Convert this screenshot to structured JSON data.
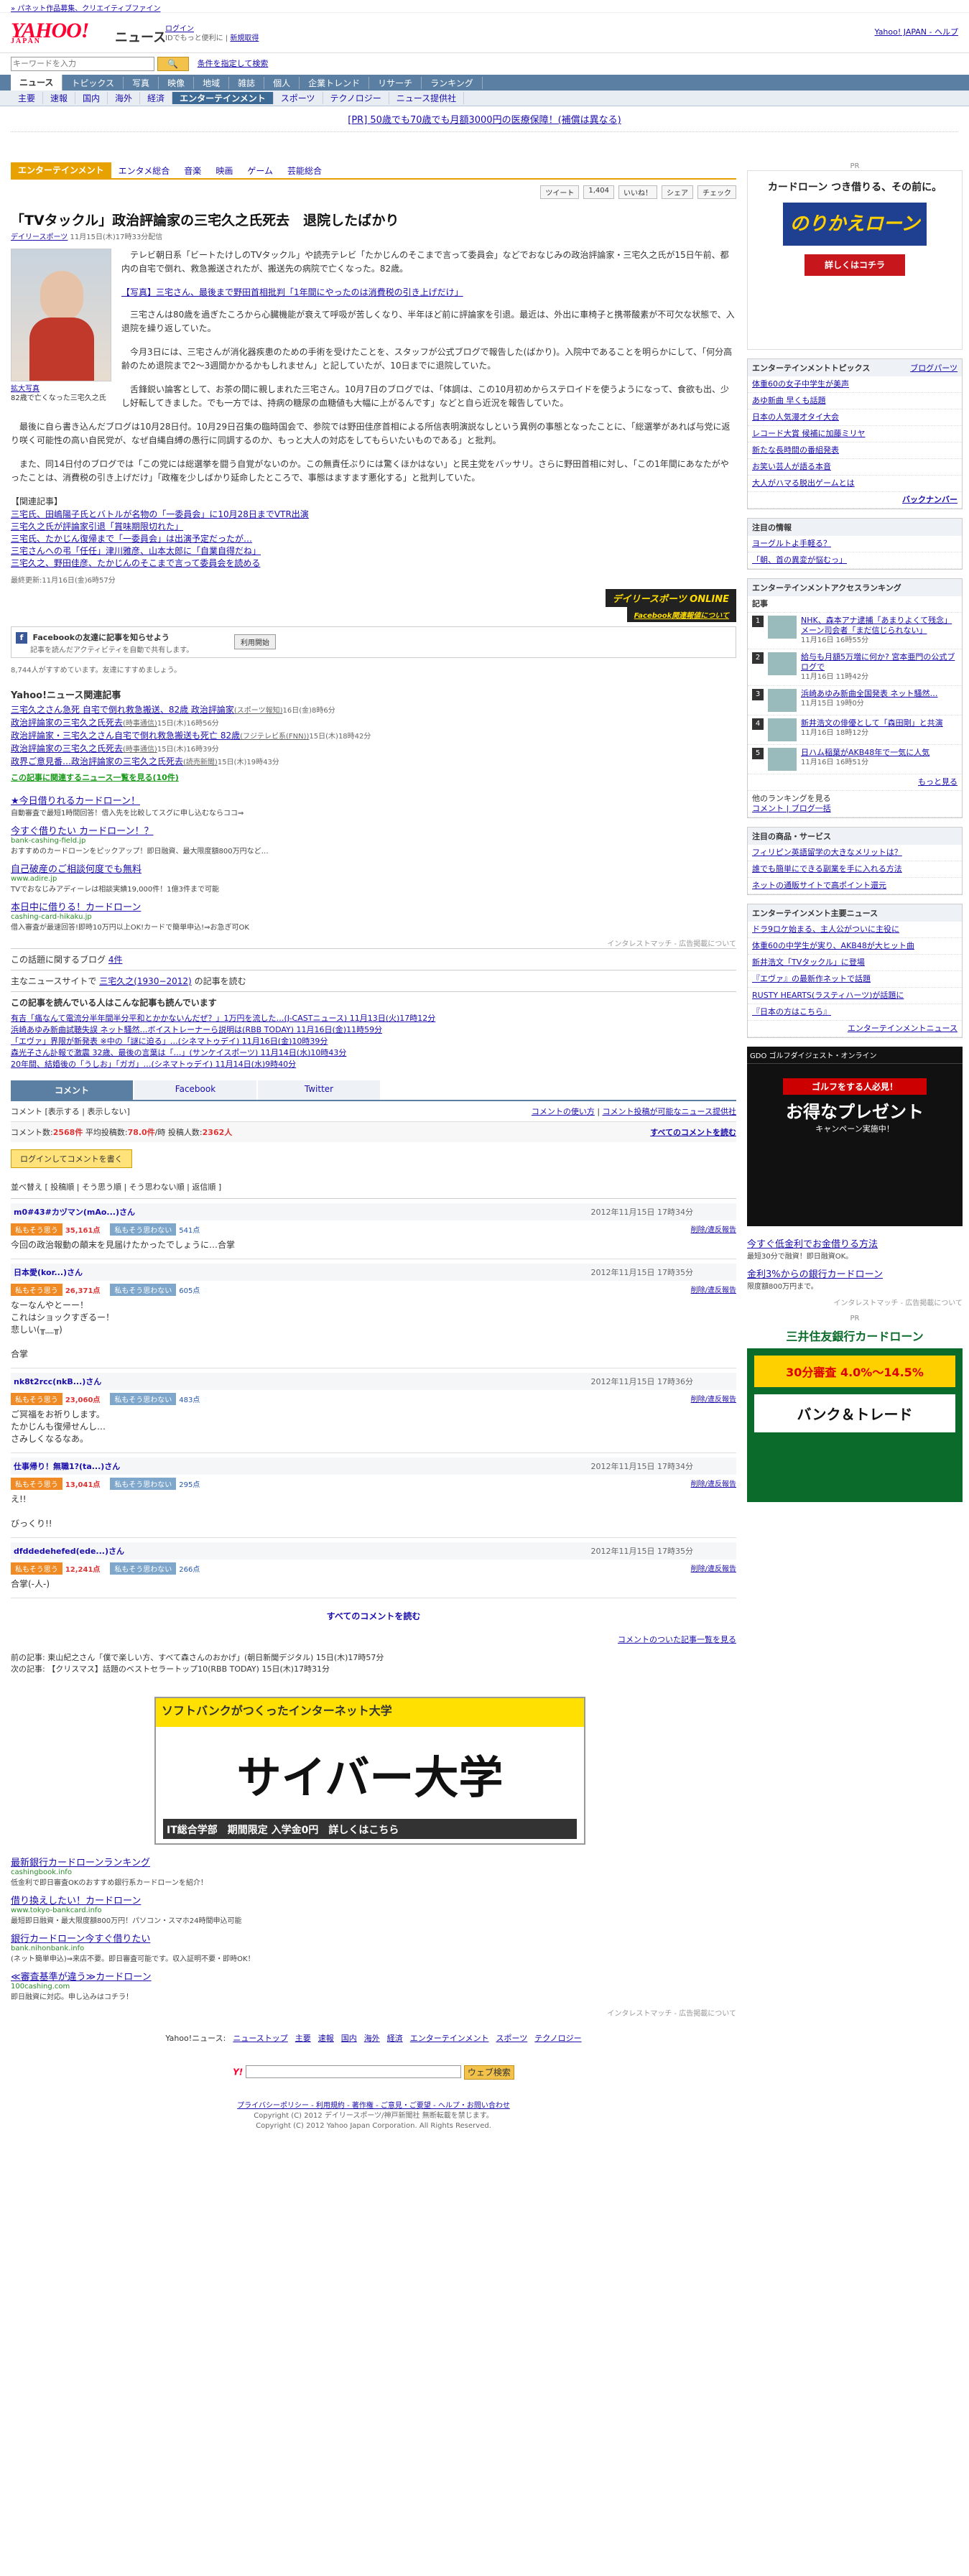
{
  "topbar": {
    "left": "» パネット作品募集、クリエイティブファイン",
    "help": "Yahoo! JAPAN - ヘルプ"
  },
  "header": {
    "logo": "YAHOO!",
    "logo_sub": "JAPAN",
    "section": "ニュース",
    "login_label": "ログイン",
    "login_sub": "IDでもっと便利に",
    "register": "新規取得",
    "right_link": "Yahoo! JAPAN - ヘルプ"
  },
  "search": {
    "placeholder": "キーワードを入力",
    "button": "検索",
    "links": [
      "条件を指定して検索",
      "ヘルプ"
    ]
  },
  "nav_main": [
    "ニュース",
    "トピックス",
    "写真",
    "映像",
    "地域",
    "雑誌",
    "個人",
    "企業トレンド",
    "リサーチ",
    "ランキング"
  ],
  "nav_sub": [
    "主要",
    "速報",
    "国内",
    "海外",
    "経済",
    "エンターテインメント",
    "スポーツ",
    "テクノロジー",
    "ニュース提供社"
  ],
  "pr_line": "[PR] 50歳でも70歳でも月額3000円の医療保障！(補償は異なる)",
  "cat_tabs": [
    "エンターテインメント",
    "エンタメ総合",
    "音楽",
    "映画",
    "ゲーム",
    "芸能総合"
  ],
  "social": {
    "tweet": "ツイート",
    "tweet_count": "1,404",
    "like": "いいね！",
    "share": "シェア",
    "check": "チェック"
  },
  "article": {
    "title": "「TVタックル」政治評論家の三宅久之氏死去　退院したばかり",
    "source": "デイリースポーツ",
    "date": "11月15日(木)17時33分配信",
    "photo_link": "拡大写真",
    "photo_caption": "82歳で亡くなった三宅久之氏",
    "p1": "テレビ朝日系「ビートたけしのTVタックル」や読売テレビ「たかじんのそこまで言って委員会」などでおなじみの政治評論家・三宅久之氏が15日午前、都内の自宅で倒れ、救急搬送されたが、搬送先の病院で亡くなった。82歳。",
    "photo_article_link": "【写真】三宅さん、最後まで野田首相批判「1年間にやったのは消費税の引き上げだけ」",
    "p2": "三宅さんは80歳を過ぎたころから心臓機能が衰えて呼吸が苦しくなり、半年ほど前に評論家を引退。最近は、外出に車椅子と携帯酸素が不可欠な状態で、入退院を繰り返していた。",
    "p3": "今月3日には、三宅さんが消化器疾患のための手術を受けたことを、スタッフが公式ブログで報告した(ばかり)。入院中であることを明らかにして、「何分高齢のため退院まで2〜3週間かかるかもしれません」と記していたが、10日までに退院していた。",
    "p4": "舌鋒鋭い論客として、お茶の間に親しまれた三宅さん。10月7日のブログでは、「体調は、この10月初めからステロイドを使うようになって、食欲も出、少し好転してきました。でも一方では、持病の糖尿の血糖値も大幅に上がるんです」などと自ら近況を報告していた。",
    "p5": "最後に自ら書き込んだブログは10月28日付。10月29日召集の臨時国会で、参院では野田佳彦首相による所信表明演説なしという異例の事態となったことに、「総選挙があれば与党に返り咲く可能性の高い自民党が、なぜ自縄自縛の愚行に同調するのか、もっと大人の対応をしてもらいたいものである」と批判。",
    "p6": "また、同14日付のブログでは「この党には総選挙を闘う自覚がないのか。この無責任ぶりには驚くほかはない」と民主党をバッサリ。さらに野田首相に対し、「この1年間にあなたがやったことは、消費税の引き上げだけ」「政権を少しばかり延命したところで、事態はますます悪化する」と批判していた。",
    "rel_head": "【関連記事】",
    "rel_links": [
      "三宅氏、田嶋陽子氏とバトルが名物の「一委員会」に10月28日までVTR出演",
      "三宅久之氏が評論家引退「賞味期限切れた」",
      "三宅氏、たかじん復帰まで「一委員会」は出演予定だったが…",
      "三宅さんへの弔「任任」津川雅彦、山本太郎に「自業自得だね」",
      "三宅久之、野田佳彦、たかじんのそこまで言って委員会を読める"
    ],
    "updated": "最終更新:11月16日(金)6時57分",
    "source_logo": "デイリースポーツ ONLINE",
    "fb_relation": "Facebook関連報値について"
  },
  "fb": {
    "title": "Facebookの友達に記事を知らせよう",
    "sub": "記事を読んだアクティビティを自動で共有します。",
    "button": "利用開始"
  },
  "likes_line": "8,744人がすすめています。友達にすすめましょう。",
  "related_news": {
    "head": "Yahoo!ニュース関連記事",
    "items": [
      {
        "t": "三宅久之さん急死 自宅で倒れ救急搬送、82歳 政治評論家",
        "s": "(スポーツ報知)",
        "d": "16日(金)8時6分"
      },
      {
        "t": "政治評論家の三宅久之氏死去",
        "s": "(時事通信)",
        "d": "15日(木)16時56分"
      },
      {
        "t": "政治評論家・三宅久之さん自宅で倒れ救急搬送も死亡 82歳",
        "s": "(フジテレビ系(FNN))",
        "d": "15日(木)18時42分"
      },
      {
        "t": "政治評論家の三宅久之氏死去",
        "s": "(時事通信)",
        "d": "15日(木)16時39分"
      },
      {
        "t": "政界ご意見番…政治評論家の三宅久之氏死去",
        "s": "(読売新聞)",
        "d": "15日(木)19時43分"
      }
    ],
    "more": "この記事に関連するニュース一覧を見る(10件)"
  },
  "ads": [
    {
      "t": "★今日借りれるカードローン！",
      "u": "",
      "d": "自動審査で最短1時間回答！借入先を比較してスグに申し込むならココ⇒"
    },
    {
      "t": "今すぐ借りたい カードローン！？",
      "u": "bank-cashing-field.jp",
      "d": "おすすめのカードローンをピックアップ！即日融資、最大限度額800万円など…"
    },
    {
      "t": "自己破産のご相談何度でも無料",
      "u": "www.adire.jp",
      "d": "TVでおなじみアディーレは相談実績19,000件！1億3件まで可能"
    },
    {
      "t": "本日中に借りる！カードローン",
      "u": "cashing-card-hikaku.jp",
      "d": "借入審査が最速回答!即時10万円以上OK!カードで簡単申込!⇒お急ぎ可OK"
    }
  ],
  "ads_footer": "インタレストマッチ - 広告掲載について",
  "blog_line": "この話題に関するブログ",
  "blog_count": "4件",
  "main_site_line": "主なニュースサイトで",
  "main_site_link": "三宅久之(1930−2012)",
  "main_site_tail": "の記事を読む",
  "reading_head": "この記事を読んでいる人はこんな記事も読んでいます",
  "reading": [
    "有吉「痛なんて電流分半年間半分平和とかかないんだぜ？」1万円を流した…(J-CASTニュース) 11月13日(火)17時12分",
    "浜崎あゆみ新曲試聴失誤 ネット騒然…ボイストレーナーら説明は(RBB TODAY) 11月16日(金)11時59分",
    "「エヴァ」界限が新発表 ※中の「謎に迫る」…(シネマトゥデイ) 11月16日(金)10時39分",
    "森光子さん訃報で激震 32歳、最後の言葉は「…」(サンケイスポーツ) 11月14日(水)10時43分",
    "20年間、結婚後の「うしお」「ガガ」…(シネマトゥデイ) 11月14日(水)9時40分"
  ],
  "comment_tabs": [
    "コメント",
    "Facebook",
    "Twitter"
  ],
  "comment_bar": {
    "left": "コメント [表示する | 表示しない]",
    "r1": "コメントの使い方",
    "r2": "コメント投稿が可能なニュース提供社"
  },
  "comment_stats": {
    "count_label": "コメント数:",
    "count": "2568件",
    "avg_label": "平均投稿数:",
    "avg": "78.0件",
    "per": "/時",
    "users_label": "投稿人数:",
    "users": "2362人",
    "all": "すべてのコメントを読む"
  },
  "login_comment": "ログインしてコメントを書く",
  "sort_line": "並べ替え [ 投稿順 | そう思う順 | そう思わない順 | 返信順 ]",
  "comments": [
    {
      "user": "m0#43#カヅマン(mAo...)さん",
      "date": "2012年11月15日 17時34分",
      "yes": "35,161点",
      "no": "541点",
      "text": "今回の政治報動の顛末を見届けたかったでしょうに…合掌"
    },
    {
      "user": "日本愛(kor...)さん",
      "date": "2012年11月15日 17時35分",
      "yes": "26,371点",
      "no": "605点",
      "text": "なーなんやとーー！\nこれはショックすぎるー！\n悲しい(╥﹏╥)\n\n合掌"
    },
    {
      "user": "nk8t2rcc(nkB...)さん",
      "date": "2012年11月15日 17時36分",
      "yes": "23,060点",
      "no": "483点",
      "text": "ご冥福をお祈りします。\nたかじんも復帰せんし…\nさみしくなるなあ。"
    },
    {
      "user": "仕事帰り！無職1?(ta...)さん",
      "date": "2012年11月15日 17時34分",
      "yes": "13,041点",
      "no": "295点",
      "text": "え!!\n\nびっくり!!"
    },
    {
      "user": "dfddedehefed(ede...)さん",
      "date": "2012年11月15日 17時35分",
      "yes": "12,241点",
      "no": "266点",
      "text": "合掌(-人-)"
    }
  ],
  "vote_yes": "私もそう思う",
  "vote_no": "私もそう思わない",
  "delete_label": "削除/違反報告",
  "all_comments": "すべてのコメントを読む",
  "comment_list_link": "コメントのついた記事一覧を見る",
  "prev_article": "前の記事: 東山紀之さん「僕で楽しい方、すべて森さんのおかげ」(朝日新聞デジタル) 15日(木)17時57分",
  "next_article": "次の記事: 【クリスマス】話題のベストセラートップ10(RBB TODAY) 15日(木)17時31分",
  "big_ad": {
    "pr": "PR",
    "top": "ソフトバンクがつくったインターネット大学",
    "mid": "サイバー大学",
    "bottom": "IT総合学部　期間限定 入学金0円　詳しくはこちら"
  },
  "ads2": [
    {
      "t": "最新銀行カードローンランキング",
      "u": "cashingbook.info",
      "d": "低金利で即日審査OKのおすすめ銀行系カードローンを紹介！"
    },
    {
      "t": "借り換えしたい！カードローン",
      "u": "www.tokyo-bankcard.info",
      "d": "最短即日融資・最大限度額800万円！パソコン・スマホ24時間申込可能"
    },
    {
      "t": "銀行カードローン今すぐ借りたい",
      "u": "bank.nihonbank.info",
      "d": "(ネット簡単申込)⇒来店不要。即日審査可能です。収入証明不要・即時OK！"
    },
    {
      "t": "≪審査基準が違う≫カードローン",
      "u": "100cashing.com",
      "d": "即日融資に対応。申し込みはコチラ！"
    }
  ],
  "footer_nav": [
    "Yahoo!ニュース:",
    "ニューストップ",
    "主要",
    "速報",
    "国内",
    "海外",
    "経済",
    "エンターテインメント",
    "スポーツ",
    "テクノロジー"
  ],
  "footer_search_btn": "ウェブ検索",
  "footer_links": "プライバシーポリシー - 利用規約 - 著作権 - ご意見・ご要望 - ヘルプ・お問い合わせ",
  "copyright1": "Copyright (C) 2012 デイリースポーツ/神戸新聞社 無断転載を禁じます。",
  "copyright2": "Copyright (C) 2012 Yahoo Japan Corporation. All Rights Reserved.",
  "side": {
    "pr": "PR",
    "ad1_head": "カードローン つき借りる、その前に。",
    "ad1_logo": "のりかえローン",
    "ad1_btn": "詳しくはコチラ",
    "topics_head": "エンターテインメントトピックス",
    "topics_link": "ブログパーツ",
    "topics": [
      "体重60の女子中学生が美声",
      "あゆ新曲 早くも話題",
      "日本の人気漫才タイ大会",
      "レコード大賞 候補に加藤ミリヤ",
      "新たな長時間の番組発表",
      "お笑い芸人が語る本音",
      "大人がハマる脱出ゲームとは"
    ],
    "backnumber": "バックナンバー",
    "spot_head": "注目の情報",
    "spot": [
      "ヨーグルトよ手軽る？",
      "「朝、首の異変が悩むっ」"
    ],
    "rank_head": "エンターテインメントアクセスランキング",
    "rank_sub": "記事",
    "rank": [
      {
        "t": "NHK、森本アナ逮捕「あまりよくて残念」メーン司会者「まだ信じられない」",
        "d": "11月16日 16時55分"
      },
      {
        "t": "給与も月額5万増に何か? 宮本亜門の公式ブログで",
        "d": "11月16日 11時42分"
      },
      {
        "t": "浜崎あゆみ新曲全国発表 ネット騒然…",
        "d": "11月15日 19時0分"
      },
      {
        "t": "新井浩文の俳優として「森田剛」と共演",
        "d": "11月16日 18時12分"
      },
      {
        "t": "日ハム稲葉がAKB48年で一気に人気",
        "d": "11月16日 16時51分"
      }
    ],
    "rank_more": "もっと見る",
    "other_ranking": "他のランキングを見る",
    "other_links": "コメント | ブログ一括",
    "svc_head": "注目の商品・サービス",
    "svc": [
      "フィリピン英語留学の大きなメリットは？",
      "誰でも簡単にできる副業を手に入れる方法",
      "ネットの通販サイトで高ポイント還元"
    ],
    "feat_head": "エンターテインメント主要ニュース",
    "feat": [
      "ドラ9ロケ始まる、主人公がついに主役に",
      "体重60の中学生が実り、AKB48が大ヒット曲",
      "新井浩文「TVタックル」に登場",
      "『エヴァ』の最新作ネットで話題",
      "RUSTY HEARTS(ラスティハーツ)が話題に",
      "『日本の方はこちら』"
    ],
    "feat_more": "エンターテインメントニュース",
    "ad2_head": "GDO ゴルフダイジェスト・オンライン",
    "ad2_banner": "ゴルフをする人必見！",
    "ad2_big": "お得なプレゼント",
    "ad2_sub": "キャンペーン実施中！",
    "sad": [
      {
        "t": "今すぐ低金利でお金借りる方法",
        "d": "最短30分で融資！即日融資OK。"
      },
      {
        "t": "金利3%からの銀行カードローン",
        "d": "限度額800万円まで。"
      }
    ],
    "ad3_head": "三井住友銀行カードローン",
    "ad3_rate": "30分審査 4.0%〜14.5%",
    "ad3_k": "バンク＆トレード"
  }
}
